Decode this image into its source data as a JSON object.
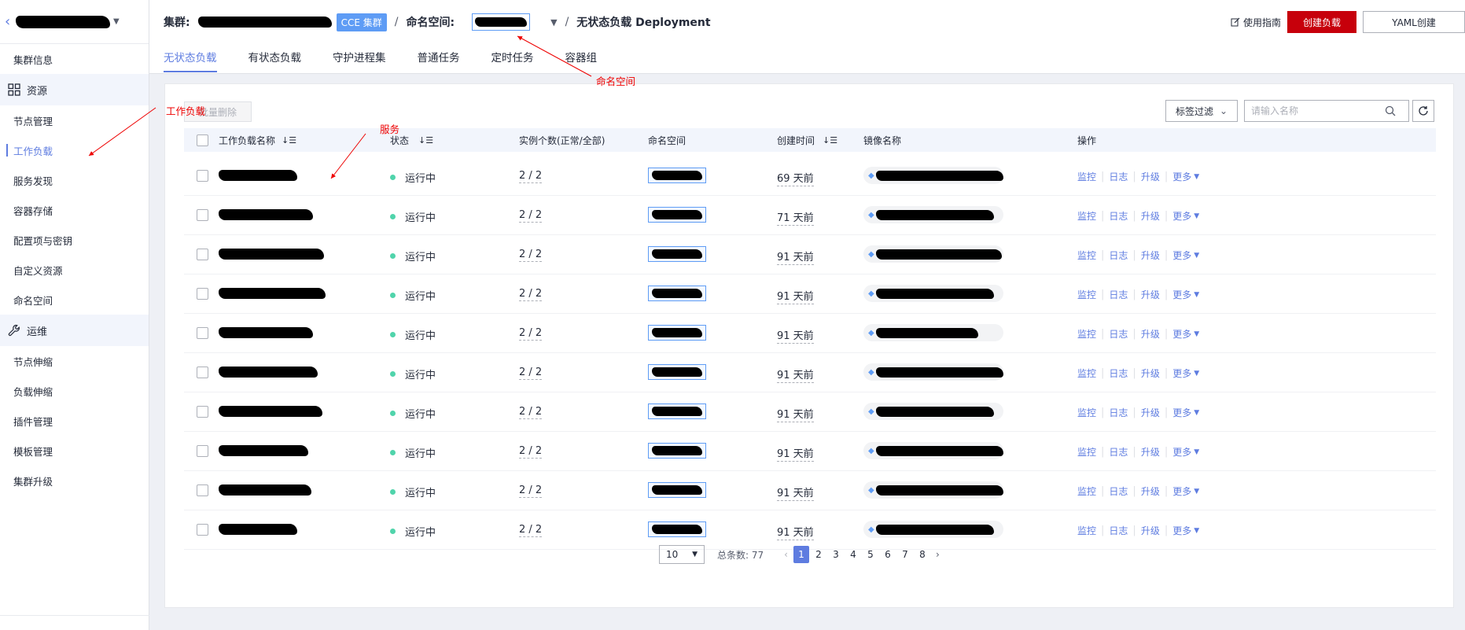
{
  "sidebar": {
    "back_icon": "chevron-left-icon",
    "items_top": [
      "集群信息"
    ],
    "group_resources": "资源",
    "resources": [
      "节点管理",
      "工作负载",
      "服务发现",
      "容器存储",
      "配置项与密钥",
      "自定义资源",
      "命名空间"
    ],
    "group_ops": "运维",
    "ops": [
      "节点伸缩",
      "负载伸缩",
      "插件管理",
      "模板管理",
      "集群升级"
    ]
  },
  "header": {
    "cluster_label": "集群:",
    "cluster_tag": "CCE 集群",
    "separator": "/",
    "namespace_label": "命名空间:",
    "page_title": "无状态负载 Deployment",
    "guide": "使用指南",
    "create_button": "创建负载",
    "yaml_button": "YAML创建"
  },
  "tabs": [
    "无状态负载",
    "有状态负载",
    "守护进程集",
    "普通任务",
    "定时任务",
    "容器组"
  ],
  "toolbar": {
    "bulk_delete": "批量删除",
    "label_filter": "标签过滤",
    "search_placeholder": "请输入名称"
  },
  "table": {
    "columns": [
      "工作负载名称",
      "状态",
      "实例个数(正常/全部)",
      "命名空间",
      "创建时间",
      "镜像名称",
      "操作"
    ],
    "rows": [
      {
        "status": "运行中",
        "instances": "2 / 2",
        "created": "69 天前"
      },
      {
        "status": "运行中",
        "instances": "2 / 2",
        "created": "71 天前"
      },
      {
        "status": "运行中",
        "instances": "2 / 2",
        "created": "91 天前"
      },
      {
        "status": "运行中",
        "instances": "2 / 2",
        "created": "91 天前"
      },
      {
        "status": "运行中",
        "instances": "2 / 2",
        "created": "91 天前"
      },
      {
        "status": "运行中",
        "instances": "2 / 2",
        "created": "91 天前"
      },
      {
        "status": "运行中",
        "instances": "2 / 2",
        "created": "91 天前"
      },
      {
        "status": "运行中",
        "instances": "2 / 2",
        "created": "91 天前"
      },
      {
        "status": "运行中",
        "instances": "2 / 2",
        "created": "91 天前"
      },
      {
        "status": "运行中",
        "instances": "2 / 2",
        "created": "91 天前"
      }
    ],
    "ops": {
      "monitor": "监控",
      "log": "日志",
      "upgrade": "升级",
      "more": "更多"
    }
  },
  "pagination": {
    "page_size": "10",
    "total": "总条数: 77",
    "pages": [
      "1",
      "2",
      "3",
      "4",
      "5",
      "6",
      "7",
      "8"
    ],
    "current": "1"
  },
  "annotations": {
    "namespace": "命名空间",
    "workload": "工作负载",
    "service": "服务"
  },
  "colors": {
    "accent": "#5e7ce0",
    "primary_button": "#c7000b",
    "running": "#50d4ab",
    "annotation": "#e00000"
  }
}
